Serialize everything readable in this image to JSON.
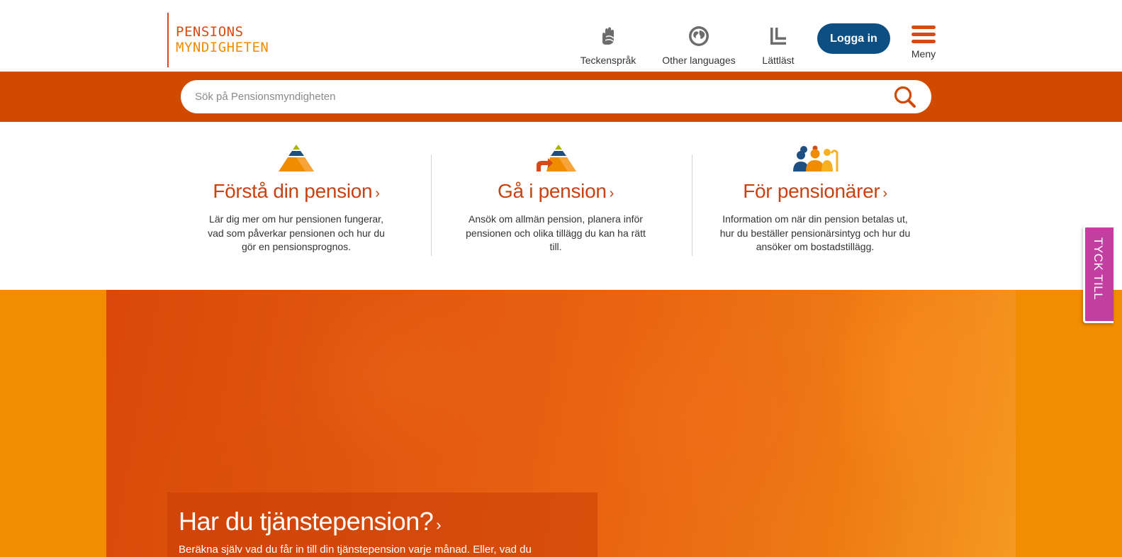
{
  "header": {
    "logo": {
      "line1": "PENSIONS",
      "line2": "MYNDIGHETEN"
    },
    "tools": [
      {
        "label": "Teckenspråk",
        "icon": "sign-language-icon"
      },
      {
        "label": "Other languages",
        "icon": "globe-icon"
      },
      {
        "label": "Lättläst",
        "icon": "easy-read-icon"
      }
    ],
    "login_label": "Logga in",
    "menu_label": "Meny"
  },
  "search": {
    "placeholder": "Sök på Pensionsmyndigheten",
    "icon": "search-icon"
  },
  "cards": [
    {
      "title": "Förstå din pension",
      "chevron": "›",
      "text": "Lär dig mer om hur pensionen fungerar, vad som påverkar pensionen och hur du gör en pensionsprognos.",
      "icon": "pension-pyramid-icon"
    },
    {
      "title": "Gå i pension",
      "chevron": "›",
      "text": "Ansök om allmän pension, planera inför pensionen och olika tillägg du kan ha rätt till.",
      "icon": "pyramid-arrow-icon"
    },
    {
      "title": "För pensionärer",
      "chevron": "›",
      "text": "Information om när din pension betalas ut, hur du beställer pensionärsintyg och hur du ansöker om bostadstillägg.",
      "icon": "pensioners-group-icon"
    }
  ],
  "hero": {
    "title": "Har du tjänstepension?",
    "chevron": "›",
    "text": "Beräkna själv vad du får in till din tjänstepension varje månad. Eller, vad du"
  },
  "feedback": {
    "label": "TYCK TILL"
  },
  "colors": {
    "brand_red": "#d04a02",
    "brand_orange": "#f28c00",
    "login_blue": "#0e4f83",
    "feedback_magenta": "#c23ea1",
    "title_red": "#c9420f"
  }
}
